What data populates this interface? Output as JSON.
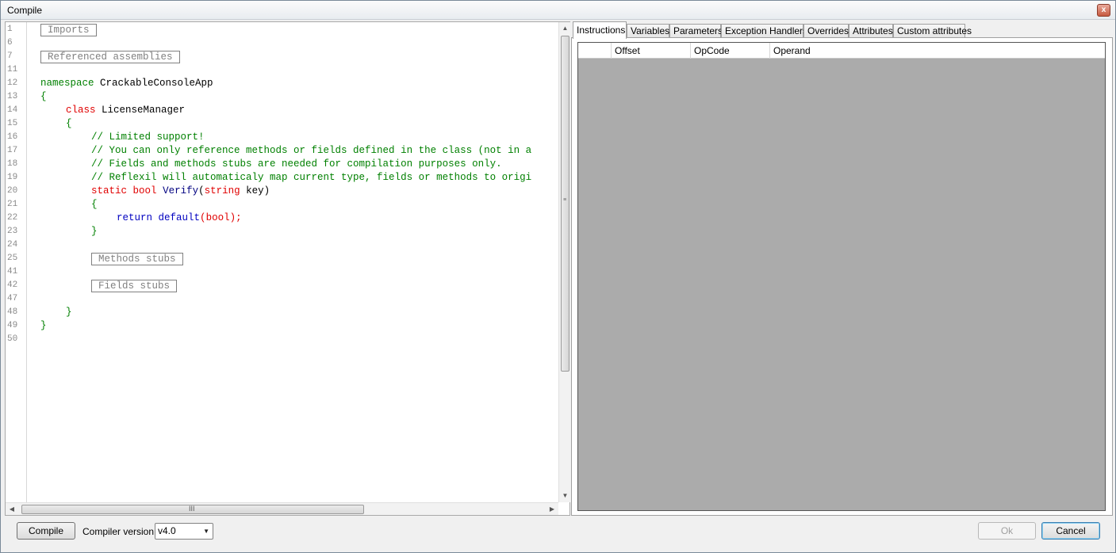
{
  "window": {
    "title": "Compile",
    "close_glyph": "x"
  },
  "editor": {
    "lines": [
      {
        "n": "1",
        "fold": "+",
        "collapsed": "Imports"
      },
      {
        "n": "6"
      },
      {
        "n": "7",
        "fold": "+",
        "collapsed": "Referenced assemblies"
      },
      {
        "n": "11"
      },
      {
        "n": "12",
        "tokens": [
          "namespace",
          " CrackableConsoleApp"
        ]
      },
      {
        "n": "13",
        "tokens": [
          "{"
        ]
      },
      {
        "n": "14",
        "tokens": [
          "class",
          " LicenseManager"
        ]
      },
      {
        "n": "15",
        "tokens": [
          "{"
        ]
      },
      {
        "n": "16",
        "tokens": [
          "// Limited support!"
        ]
      },
      {
        "n": "17",
        "tokens": [
          "// You can only reference methods or fields defined in the class (not in a"
        ]
      },
      {
        "n": "18",
        "tokens": [
          "// Fields and methods stubs are needed for compilation purposes only."
        ]
      },
      {
        "n": "19",
        "tokens": [
          "// Reflexil will automaticaly map current type, fields or methods to origi"
        ]
      },
      {
        "n": "20",
        "tokens": [
          "static",
          " ",
          "bool",
          " ",
          "Verify",
          "(",
          "string",
          " key)"
        ]
      },
      {
        "n": "21",
        "tokens": [
          "{"
        ]
      },
      {
        "n": "22",
        "tokens": [
          "return",
          " ",
          "default",
          "(",
          "bool",
          ");"
        ]
      },
      {
        "n": "23",
        "tokens": [
          "}"
        ]
      },
      {
        "n": "24"
      },
      {
        "n": "25",
        "fold": "+",
        "collapsed": "Methods stubs"
      },
      {
        "n": "41"
      },
      {
        "n": "42",
        "fold": "+",
        "collapsed": "Fields stubs"
      },
      {
        "n": "47"
      },
      {
        "n": "48",
        "tokens": [
          "}"
        ]
      },
      {
        "n": "49",
        "tokens": [
          "}"
        ]
      },
      {
        "n": "50"
      }
    ],
    "vscroll_grip": "≡",
    "hscroll_grip": "III",
    "arrow_up": "▲",
    "arrow_down": "▼",
    "arrow_left": "◀",
    "arrow_right": "▶"
  },
  "tabs": [
    {
      "label": "Instructions",
      "active": true
    },
    {
      "label": "Variables"
    },
    {
      "label": "Parameters"
    },
    {
      "label": "Exception Handlers"
    },
    {
      "label": "Overrides"
    },
    {
      "label": "Attributes"
    },
    {
      "label": "Custom attributes"
    }
  ],
  "grid": {
    "columns": [
      "",
      "Offset",
      "OpCode",
      "Operand"
    ]
  },
  "footer": {
    "compile_label": "Compile",
    "compiler_version_label": "Compiler version:",
    "compiler_version_value": "v4.0",
    "dropdown_glyph": "▼",
    "ok_label": "Ok",
    "cancel_label": "Cancel"
  },
  "colors": {
    "keyword_green": "#008000",
    "keyword_red": "#e00000",
    "keyword_blue": "#0000c0",
    "grid_background": "#ababab"
  }
}
